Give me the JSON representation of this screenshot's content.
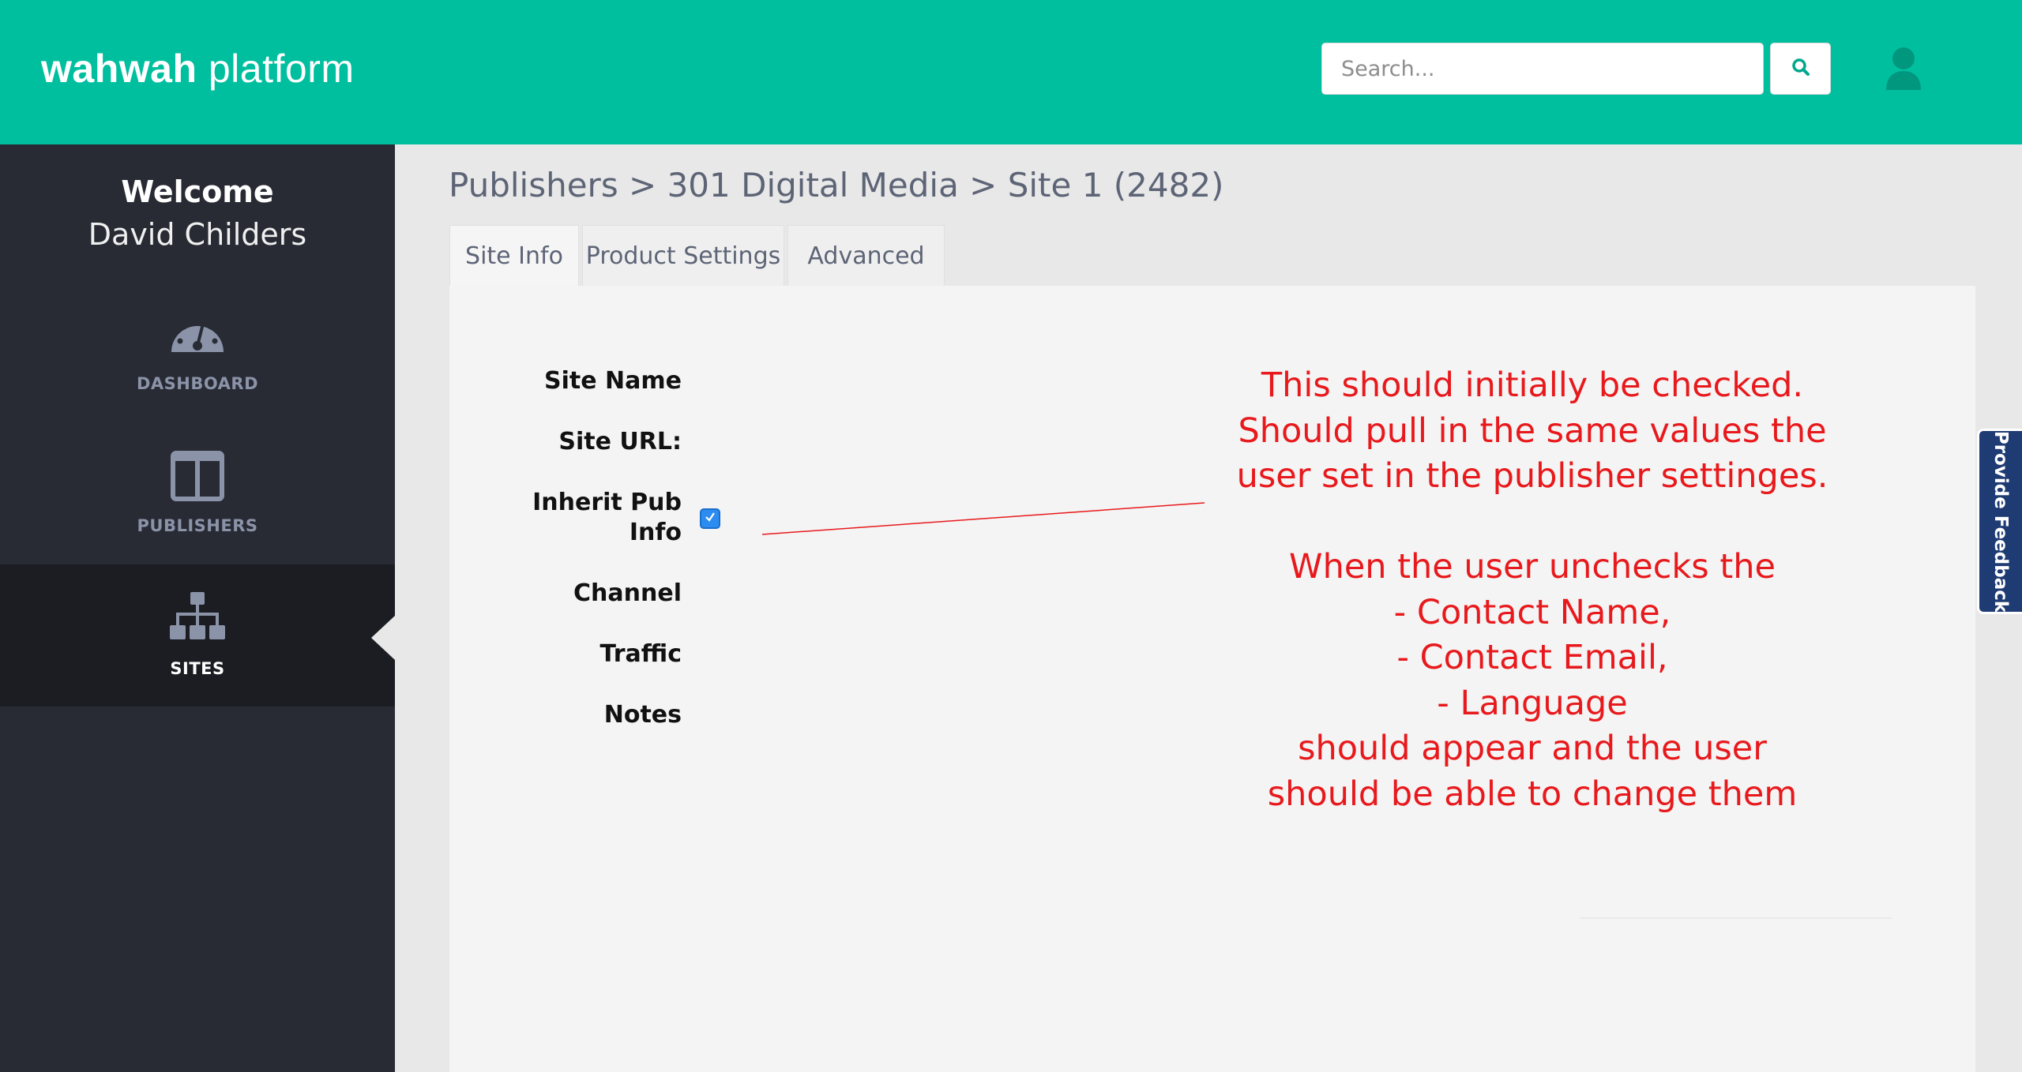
{
  "header": {
    "brand_bold": "wahwah",
    "brand_rest": " platform",
    "search_placeholder": "Search...",
    "search_icon": "search-icon",
    "user_icon": "user-icon"
  },
  "sidebar": {
    "welcome": "Welcome",
    "username": "David Childers",
    "items": [
      {
        "label": "DASHBOARD",
        "icon": "dashboard-gauge-icon",
        "active": false
      },
      {
        "label": "PUBLISHERS",
        "icon": "columns-icon",
        "active": false
      },
      {
        "label": "SITES",
        "icon": "sitemap-icon",
        "active": true
      }
    ]
  },
  "main": {
    "breadcrumb": "Publishers > 301 Digital Media > Site 1 (2482)",
    "tabs": [
      {
        "label": "Site Info",
        "active": true
      },
      {
        "label": "Product Settings",
        "active": false
      },
      {
        "label": "Advanced",
        "active": false
      }
    ],
    "form": {
      "site_name_label": "Site Name",
      "site_url_label": "Site URL:",
      "inherit_label_line1": "Inherit Pub",
      "inherit_label_line2": "Info",
      "inherit_checked": true,
      "channel_label": "Channel",
      "traffic_label": "Traffic",
      "notes_label": "Notes"
    },
    "annotation": "This should initially be checked.\nShould pull in the same values the\nuser set in the publisher settinges.\n\nWhen the user unchecks the\n- Contact Name,\n- Contact Email,\n- Language\nshould appear and the user\nshould be able to change them",
    "annotation_color": "#e8191c"
  },
  "feedback": {
    "label": "Provide Feedback"
  },
  "colors": {
    "topbar": "#00bf9f",
    "sidebar": "#282b34",
    "sidebar_active": "#1c1d23",
    "accent_blue": "#2d8cf0"
  }
}
